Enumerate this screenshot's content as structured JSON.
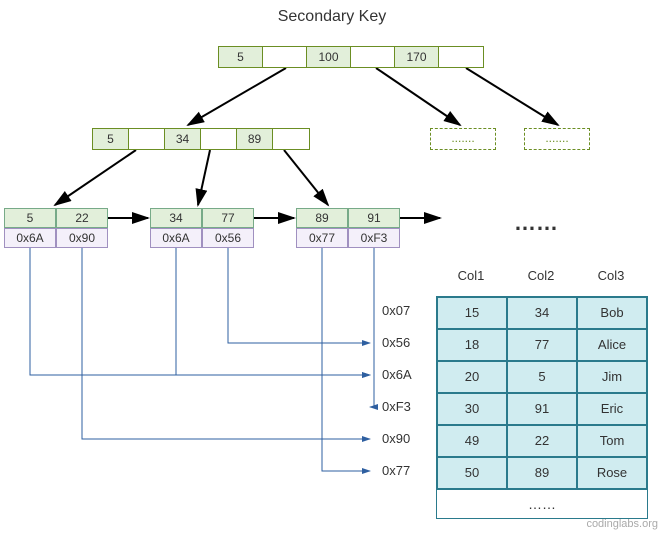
{
  "title": "Secondary Key",
  "root": {
    "k0": "5",
    "k1": "100",
    "k2": "170"
  },
  "internal": {
    "k0": "5",
    "k1": "34",
    "k2": "89"
  },
  "dashed_ellipsis": ".......",
  "leaf1": {
    "k0": "5",
    "k1": "22",
    "v0": "0x6A",
    "v1": "0x90"
  },
  "leaf2": {
    "k0": "34",
    "k1": "77",
    "v0": "0x6A",
    "v1": "0x56"
  },
  "leaf3": {
    "k0": "89",
    "k1": "91",
    "v0": "0x77",
    "v1": "0xF3"
  },
  "big_ellipsis": "……",
  "addresses": [
    "0x07",
    "0x56",
    "0x6A",
    "0xF3",
    "0x90",
    "0x77"
  ],
  "table": {
    "headers": [
      "Col1",
      "Col2",
      "Col3"
    ],
    "rows": [
      [
        "15",
        "34",
        "Bob"
      ],
      [
        "18",
        "77",
        "Alice"
      ],
      [
        "20",
        "5",
        "Jim"
      ],
      [
        "30",
        "91",
        "Eric"
      ],
      [
        "49",
        "22",
        "Tom"
      ],
      [
        "50",
        "89",
        "Rose"
      ]
    ],
    "footer": "……"
  },
  "watermark": "codinglabs.org",
  "chart_data": {
    "type": "table",
    "title": "Secondary Key",
    "description": "B+Tree secondary index diagram: internal nodes hold keys, leaf nodes hold (key, row-pointer) pairs; pointers reference rows in a heap table.",
    "btree": {
      "root": {
        "keys": [
          5,
          100,
          170
        ]
      },
      "children_of_root": [
        {
          "keys": [
            5,
            34,
            89
          ]
        },
        {
          "placeholder": true
        },
        {
          "placeholder": true
        }
      ],
      "leaves": [
        {
          "keys": [
            5,
            22
          ],
          "pointers": [
            "0x6A",
            "0x90"
          ]
        },
        {
          "keys": [
            34,
            77
          ],
          "pointers": [
            "0x6A",
            "0x56"
          ]
        },
        {
          "keys": [
            89,
            91
          ],
          "pointers": [
            "0x77",
            "0xF3"
          ]
        }
      ]
    },
    "heap_rows": [
      {
        "addr": "0x07",
        "Col1": 15,
        "Col2": 34,
        "Col3": "Bob"
      },
      {
        "addr": "0x56",
        "Col1": 18,
        "Col2": 77,
        "Col3": "Alice"
      },
      {
        "addr": "0x6A",
        "Col1": 20,
        "Col2": 5,
        "Col3": "Jim"
      },
      {
        "addr": "0xF3",
        "Col1": 30,
        "Col2": 91,
        "Col3": "Eric"
      },
      {
        "addr": "0x90",
        "Col1": 49,
        "Col2": 22,
        "Col3": "Tom"
      },
      {
        "addr": "0x77",
        "Col1": 50,
        "Col2": 89,
        "Col3": "Rose"
      }
    ]
  }
}
